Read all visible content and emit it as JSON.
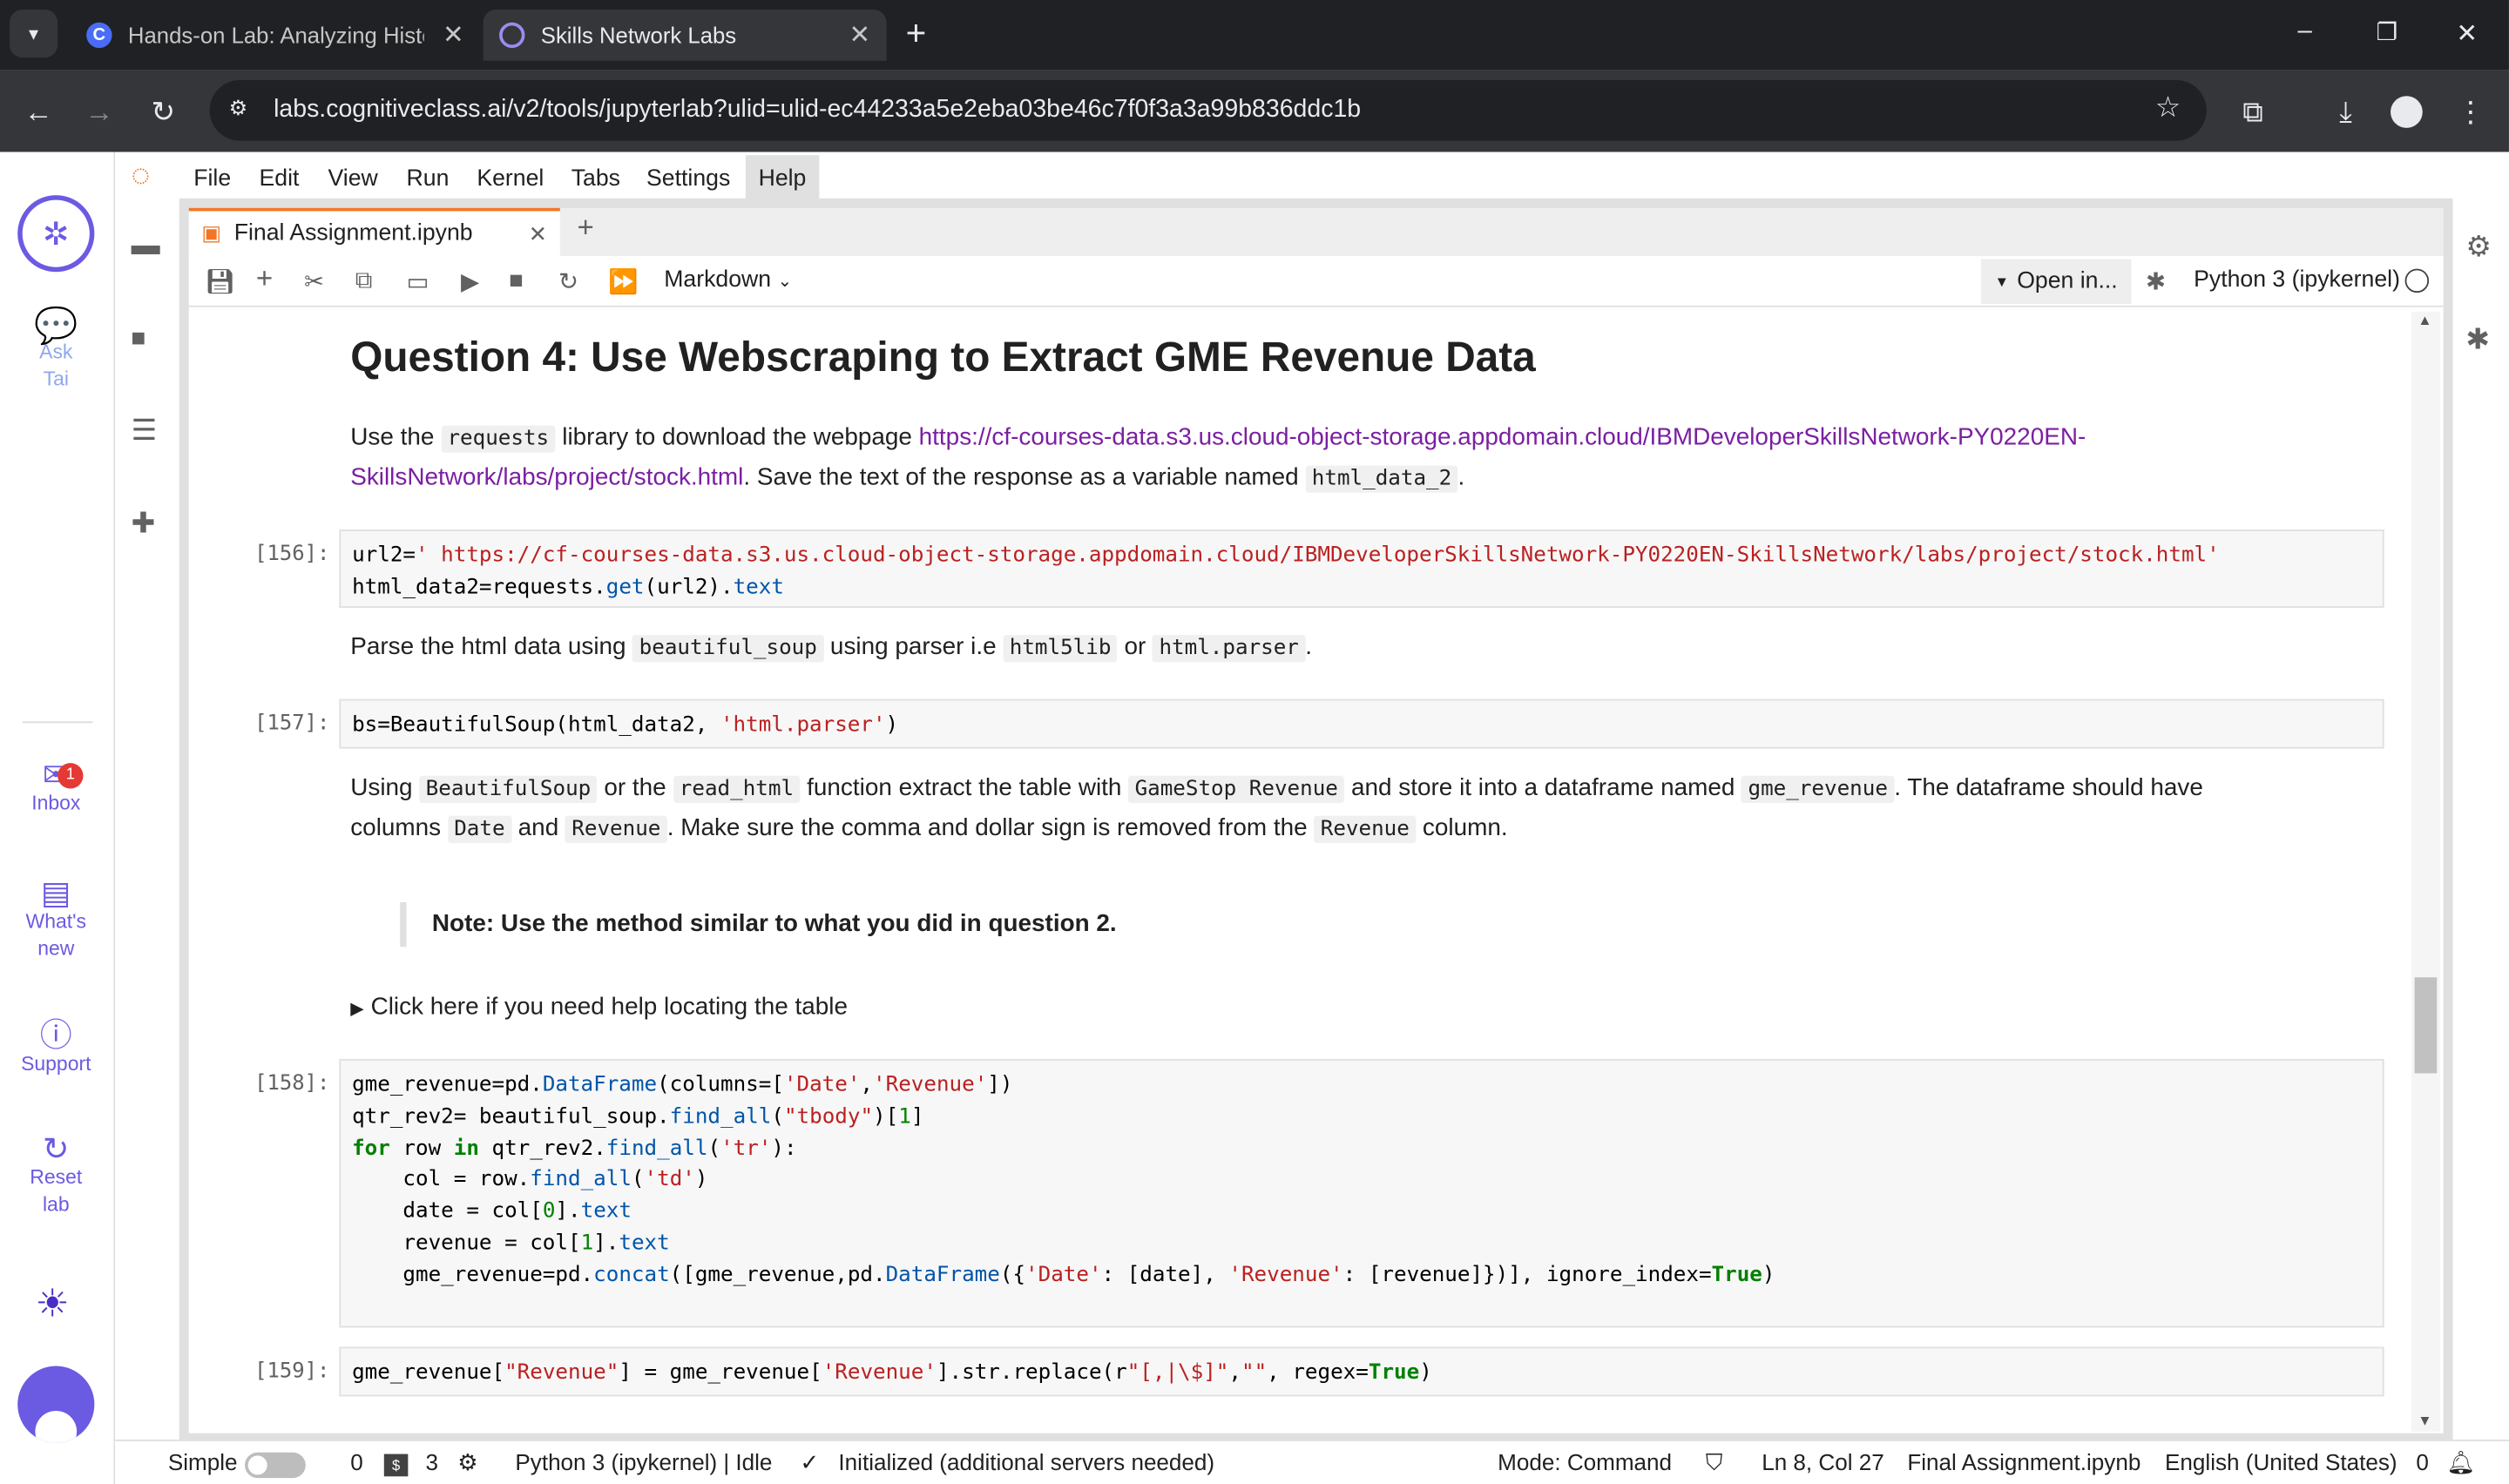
{
  "browser": {
    "tabs": [
      {
        "title": "Hands-on Lab: Analyzing Histor",
        "favicon": "C"
      },
      {
        "title": "Skills Network Labs"
      }
    ],
    "new_tab": "+",
    "url": "labs.cognitiveclass.ai/v2/tools/jupyterlab?ulid=ulid-ec44233a5e2eba03be46c7f0f3a3a99b836ddc1b",
    "window_controls": [
      "–",
      "❐",
      "✕"
    ]
  },
  "rail": {
    "items": [
      {
        "label1": "Ask",
        "label2": "Tai"
      },
      {
        "label1": "Inbox",
        "badge": "1"
      },
      {
        "label1": "What's",
        "label2": "new"
      },
      {
        "label1": "Support"
      },
      {
        "label1": "Reset",
        "label2": "lab"
      }
    ]
  },
  "menubar": [
    "File",
    "Edit",
    "View",
    "Run",
    "Kernel",
    "Tabs",
    "Settings",
    "Help"
  ],
  "notebook_tab": {
    "title": "Final Assignment.ipynb",
    "close": "✕",
    "add": "+"
  },
  "toolbar": {
    "cell_type": "Markdown",
    "open_in": "Open in...",
    "kernel": "Python 3 (ipykernel)"
  },
  "content": {
    "heading": "Question 4: Use Webscraping to Extract GME Revenue Data",
    "p1_a": "Use the ",
    "p1_code": "requests",
    "p1_b": " library to download the webpage ",
    "p1_link1": "https://cf-courses-data.s3.us.cloud-object-storage.appdomain.cloud/IBMDeveloperSkillsNetwork-PY0220EN-",
    "p1_link2": "SkillsNetwork/labs/project/stock.html",
    "p1_c": ". Save the text of the response as a variable named ",
    "p1_code2": "html_data_2",
    "p1_d": ".",
    "cell156": {
      "prompt": "[156]:",
      "line1a": "url2=",
      "line1b": "' https://cf-courses-data.s3.us.cloud-object-storage.appdomain.cloud/IBMDeveloperSkillsNetwork-PY0220EN-SkillsNetwork/labs/project/stock.html'",
      "line2a": "html_data2=requests.",
      "line2b": "get",
      "line2c": "(url2).",
      "line2d": "text"
    },
    "p2_a": "Parse the html data using ",
    "p2_code1": "beautiful_soup",
    "p2_b": " using parser i.e ",
    "p2_code2": "html5lib",
    "p2_c": " or ",
    "p2_code3": "html.parser",
    "p2_d": ".",
    "cell157": {
      "prompt": "[157]:",
      "a": "bs=BeautifulSoup(html_data2, ",
      "b": "'html.parser'",
      "c": ")"
    },
    "p3_a": "Using ",
    "p3_code1": "BeautifulSoup",
    "p3_b": " or the ",
    "p3_code2": "read_html",
    "p3_c": " function extract the table with ",
    "p3_code3": "GameStop Revenue",
    "p3_d": " and store it into a dataframe named ",
    "p3_code4": "gme_revenue",
    "p3_e": ". The dataframe should have",
    "p3_f": "columns ",
    "p3_code5": "Date",
    "p3_g": " and ",
    "p3_code6": "Revenue",
    "p3_h": ". Make sure the comma and dollar sign is removed from the ",
    "p3_code7": "Revenue",
    "p3_i": " column.",
    "note": "Note: Use the method similar to what you did in question 2.",
    "details": "Click here if you need help locating the table",
    "cell158": {
      "prompt": "[158]:",
      "l1a": "gme_revenue=pd.",
      "l1b": "DataFrame",
      "l1c": "(columns=[",
      "l1d": "'Date'",
      "l1e": ",",
      "l1f": "'Revenue'",
      "l1g": "])",
      "l2a": "qtr_rev2= beautiful_soup.",
      "l2b": "find_all",
      "l2c": "(",
      "l2d": "\"tbody\"",
      "l2e": ")[",
      "l2f": "1",
      "l2g": "]",
      "l3a": "for",
      "l3b": " row ",
      "l3c": "in",
      "l3d": " qtr_rev2.",
      "l3e": "find_all",
      "l3f": "(",
      "l3g": "'tr'",
      "l3h": "):",
      "l4a": "    col = row.",
      "l4b": "find_all",
      "l4c": "(",
      "l4d": "'td'",
      "l4e": ")",
      "l5a": "    date = col[",
      "l5b": "0",
      "l5c": "].",
      "l5d": "text",
      "l6a": "    revenue = col[",
      "l6b": "1",
      "l6c": "].",
      "l6d": "text",
      "l7a": "    gme_revenue=pd.",
      "l7b": "concat",
      "l7c": "([gme_revenue,pd.",
      "l7d": "DataFrame",
      "l7e": "({",
      "l7f": "'Date'",
      "l7g": ": [date], ",
      "l7h": "'Revenue'",
      "l7i": ": [revenue]})], ignore_index=",
      "l7j": "True",
      "l7k": ")"
    },
    "cell159": {
      "prompt": "[159]:",
      "a": "gme_revenue[",
      "b": "\"Revenue\"",
      "c": "] = gme_revenue[",
      "d": "'Revenue'",
      "e": "].str.replace(r",
      "f": "\"[,|\\$]\"",
      "g": ",",
      "h": "\"\"",
      "i": ", regex=",
      "j": "True",
      "k": ")"
    }
  },
  "statusbar": {
    "simple": "Simple",
    "zero": "0",
    "terminals": "3",
    "kernel_status": "Python 3 (ipykernel) | Idle",
    "init": "Initialized (additional servers needed)",
    "mode": "Mode: Command",
    "position": "Ln 8, Col 27",
    "file": "Final Assignment.ipynb",
    "lang": "English (United States)",
    "notif": "0"
  }
}
